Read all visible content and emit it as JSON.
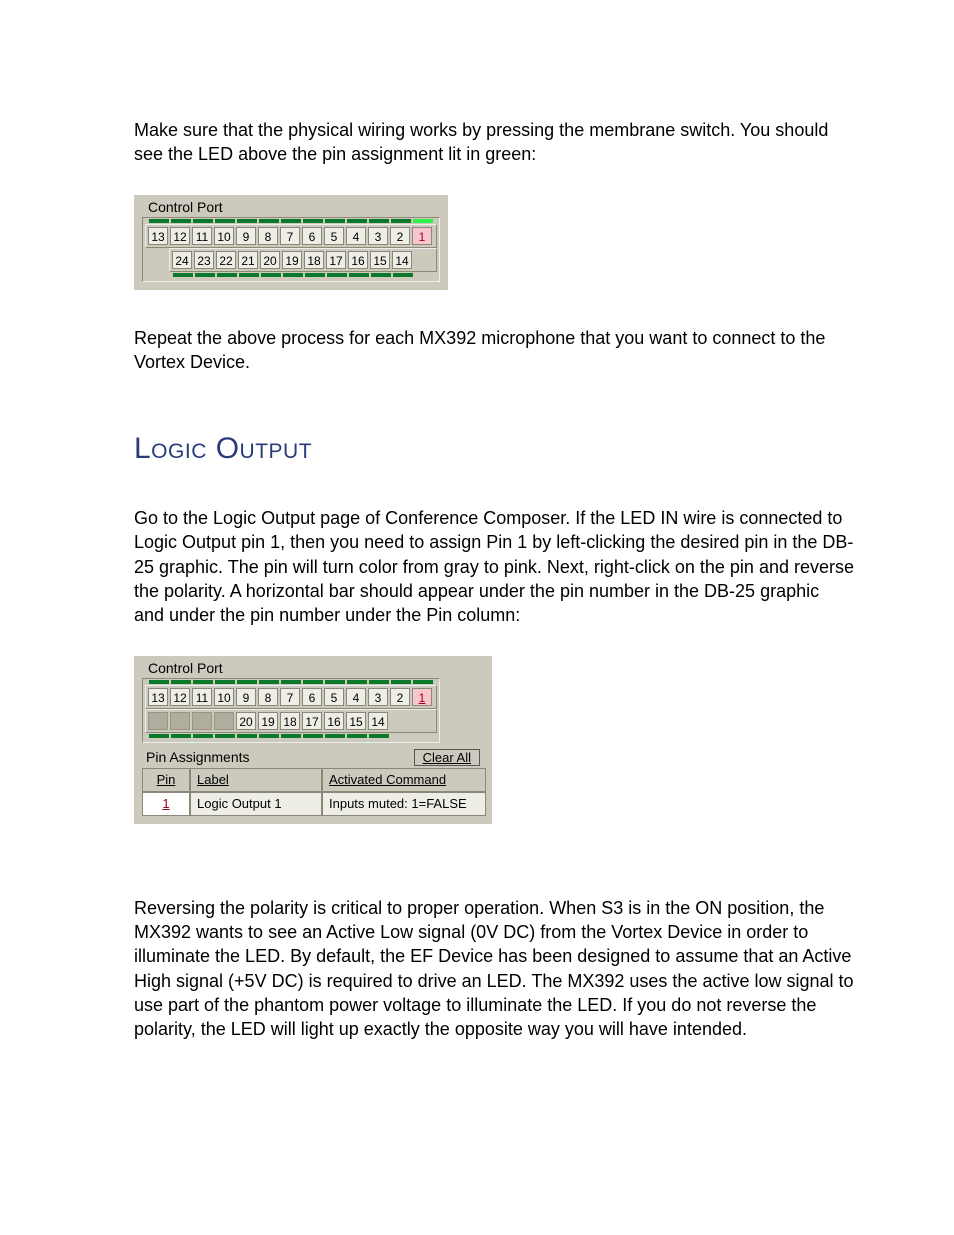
{
  "intro": {
    "p1": "Make sure that the physical wiring works by pressing the membrane switch.  You should see the LED above the pin assignment lit in green:",
    "p2": "Repeat the above process for each MX392 microphone that you want to connect to the Vortex Device."
  },
  "fig1": {
    "title": "Control Port",
    "row1": [
      "13",
      "12",
      "11",
      "10",
      "9",
      "8",
      "7",
      "6",
      "5",
      "4",
      "3",
      "2",
      "1"
    ],
    "row2": [
      "24",
      "23",
      "22",
      "21",
      "20",
      "19",
      "18",
      "17",
      "16",
      "15",
      "14"
    ],
    "active_pin": "1",
    "lit_led_index_top": 12
  },
  "section": {
    "heading": "Logic Output",
    "p3": "Go to the Logic Output page of Conference Composer.  If the LED IN wire is connected to Logic Output pin 1, then you need to assign Pin 1 by left-clicking the desired pin in the DB-25 graphic.  The pin will turn color from gray to pink. Next, right-click on the pin and reverse the polarity.  A horizontal bar should appear under the pin number in the DB-25 graphic and under the pin number under the Pin column:",
    "p4": "Reversing the polarity is critical to proper operation.  When S3 is in the ON position, the MX392 wants to see an Active Low signal (0V DC) from the Vortex Device in order to illuminate the LED.  By default, the EF Device has been designed to assume that an Active High signal (+5V DC) is required to drive an LED.  The MX392 uses the active low signal to use part of the phantom power voltage to illuminate the LED.  If you do not reverse the polarity, the LED will light up exactly the opposite way you will have intended."
  },
  "fig2": {
    "title": "Control Port",
    "row1": [
      "13",
      "12",
      "11",
      "10",
      "9",
      "8",
      "7",
      "6",
      "5",
      "4",
      "3",
      "2",
      "1"
    ],
    "row2_blanks": 4,
    "row2": [
      "20",
      "19",
      "18",
      "17",
      "16",
      "15",
      "14"
    ],
    "active_pin": "1",
    "pin_assignments_label": "Pin Assignments",
    "clear_all": "Clear All",
    "headers": {
      "pin": "Pin",
      "label": "Label",
      "cmd": "Activated Command"
    },
    "row": {
      "pin": "1",
      "label": "Logic Output 1",
      "cmd": "Inputs muted: 1=FALSE"
    }
  }
}
